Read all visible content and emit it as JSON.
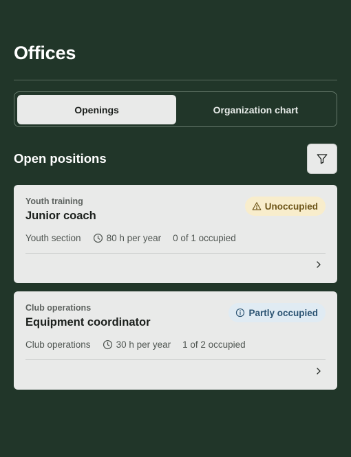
{
  "page": {
    "title": "Offices"
  },
  "tabs": [
    {
      "label": "Openings",
      "active": true
    },
    {
      "label": "Organization chart",
      "active": false
    }
  ],
  "section": {
    "title": "Open positions",
    "filter_icon": "filter-icon"
  },
  "positions": [
    {
      "category": "Youth training",
      "title": "Junior coach",
      "status": "Unoccupied",
      "status_icon": "warning-icon",
      "status_color": "#6e5619",
      "department": "Youth section",
      "hours": "80 h per year",
      "occupancy": "0 of 1 occupied"
    },
    {
      "category": "Club operations",
      "title": "Equipment coordinator",
      "status": "Partly occupied",
      "status_icon": "info-icon",
      "status_color": "#2b5372",
      "department": "Club operations",
      "hours": "30 h per year",
      "occupancy": "1 of 2 occupied"
    }
  ],
  "colors": {
    "background": "#213629",
    "card": "#e9eae9",
    "warning_badge": "#f8edcc",
    "info_badge": "#e0ebf3"
  }
}
